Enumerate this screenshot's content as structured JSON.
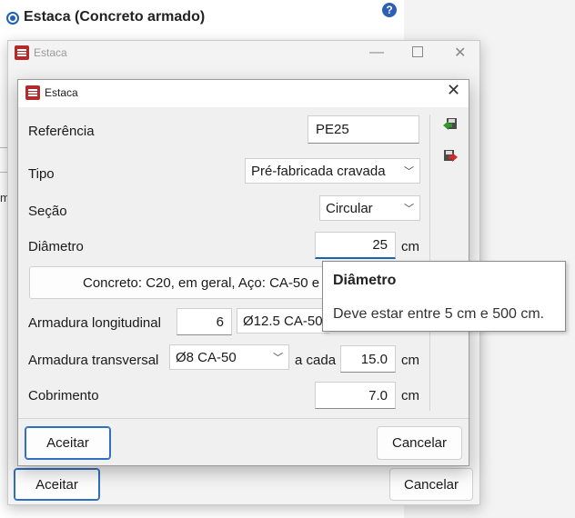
{
  "background_window": {
    "option_label": "Estaca (Concreto armado)",
    "help_icon": "question-icon",
    "side_char": "m"
  },
  "middle_window": {
    "title": "Estaca",
    "accept_label": "Aceitar",
    "cancel_label": "Cancelar"
  },
  "dialog": {
    "title": "Estaca",
    "close_glyph": "✕",
    "fields": {
      "referencia": {
        "label": "Referência",
        "value": "PE25"
      },
      "tipo": {
        "label": "Tipo",
        "value": "Pré-fabricada cravada"
      },
      "secao": {
        "label": "Seção",
        "value": "Circular"
      },
      "diametro": {
        "label": "Diâmetro",
        "value": "25",
        "unit": "cm"
      },
      "material_button": "Concreto: C20, em geral, Aço: CA-50 e",
      "arm_long": {
        "label": "Armadura longitudinal",
        "count": "6",
        "bar": "Ø12.5 CA-50"
      },
      "arm_trans": {
        "label": "Armadura transversal",
        "bar": "Ø8 CA-50",
        "each_label": "a cada",
        "spacing": "15.0",
        "unit": "cm"
      },
      "cobrimento": {
        "label": "Cobrimento",
        "value": "7.0",
        "unit": "cm"
      }
    },
    "side_tools": [
      "import-icon",
      "export-icon"
    ],
    "accept_label": "Aceitar",
    "cancel_label": "Cancelar"
  },
  "tooltip": {
    "title": "Diâmetro",
    "text": "Deve estar entre 5 cm e 500 cm."
  },
  "colors": {
    "accent": "#1f5fb6",
    "icon_red": "#b22a2a"
  }
}
